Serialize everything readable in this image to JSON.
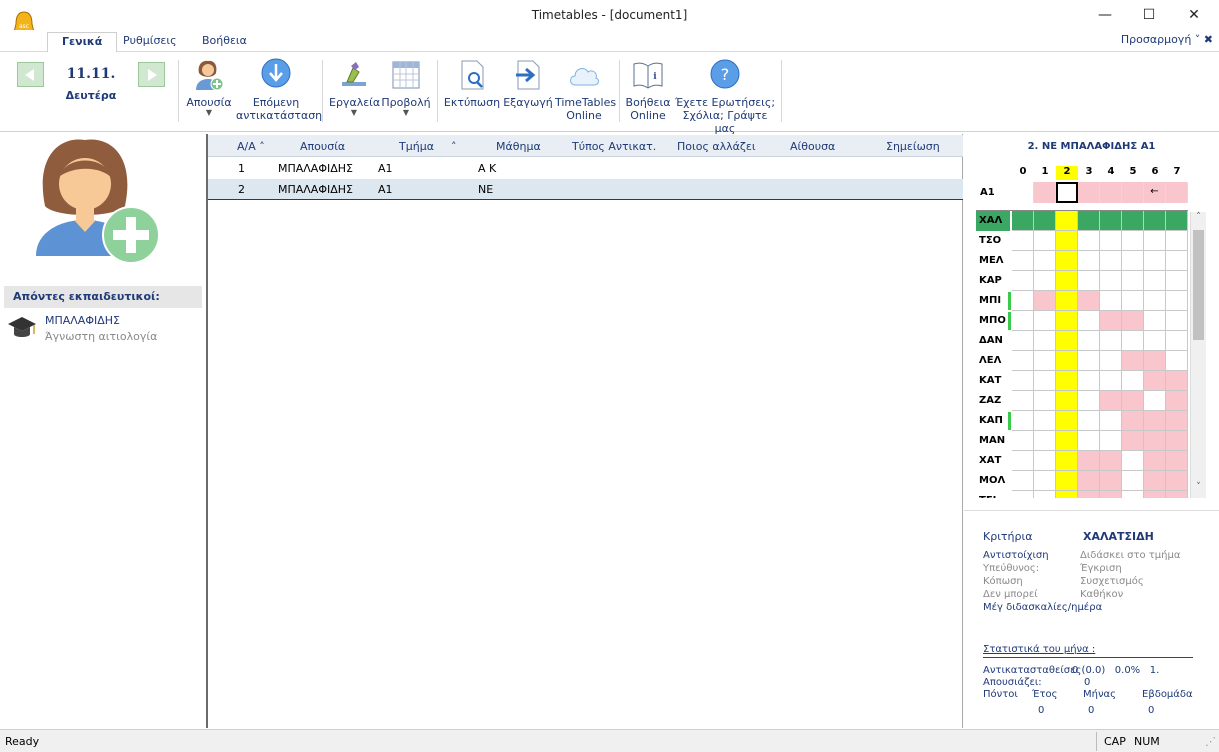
{
  "window": {
    "title": "Timetables - [document1]",
    "minimize": "—",
    "maximize": "☐",
    "close": "✕"
  },
  "tabs": [
    {
      "label": "Γενικά"
    },
    {
      "label": "Ρυθμίσεις"
    },
    {
      "label": "Βοήθεια"
    }
  ],
  "customize": "Προσαρμογή ˅ ✖",
  "date": {
    "main": "11.11.",
    "day": "Δευτέρα"
  },
  "ribbon": {
    "absence": "Απουσία",
    "next_sub_1": "Επόμενη",
    "next_sub_2": "αντικατάσταση",
    "tools": "Εργαλεία",
    "view": "Προβολή",
    "print": "Εκτύπωση",
    "export": "Εξαγωγή",
    "online_1": "TimeTables",
    "online_2": "Online",
    "help_1": "Βοήθεια",
    "help_2": "Online",
    "questions_1": "Έχετε Ερωτήσεις;",
    "questions_2": "Σχόλια; Γράψτε μας"
  },
  "left": {
    "absent_header": "Απόντες εκπαιδευτικοί:",
    "teacher_name": "ΜΠΑΛΑΦΙΔΗΣ",
    "teacher_reason": "Άγνωστη αιτιολογία"
  },
  "table": {
    "columns": [
      "Α/Α ˄",
      "Απουσία",
      "Τμήμα",
      "˄",
      "Μάθημα",
      "Τύπος Αντικατ.",
      "Ποιος αλλάζει",
      "Αίθουσα",
      "Σημείωση"
    ],
    "rows": [
      {
        "num": "1",
        "absence": "ΜΠΑΛΑΦΙΔΗΣ",
        "class": "Α1",
        "subject": "Α Κ"
      },
      {
        "num": "2",
        "absence": "ΜΠΑΛΑΦΙΔΗΣ",
        "class": "Α1",
        "subject": "ΝΕ"
      }
    ]
  },
  "right": {
    "title": "2. ΝΕ ΜΠΑΛΑΦΙΔΗΣ Α1",
    "periods": [
      "0",
      "1",
      "2",
      "3",
      "4",
      "5",
      "6",
      "7"
    ],
    "class_row_label": "Α1",
    "arrow": "←",
    "teachers": [
      "ΧΑΛ",
      "ΤΣΟ",
      "ΜΕΛ",
      "ΚΑΡ",
      "ΜΠΙ",
      "ΜΠΟ",
      "ΔΑΝ",
      "ΛΕΛ",
      "ΚΑΤ",
      "ΖΑΖ",
      "ΚΑΠ",
      "ΜΑΝ",
      "ΧΑΤ",
      "ΜΟΛ",
      "ΤΣΙ"
    ],
    "criteria": "Κριτήρια",
    "criteria_name": "ΧΑΛΑΤΣΙΔΗ",
    "c_left": [
      "Αντιστοίχιση",
      "Υπεύθυνος:",
      "Κόπωση",
      "Δεν μπορεί",
      "Μέγ διδασκαλίες/ημέρα"
    ],
    "c_right": [
      "Διδάσκει στο τμήμα",
      "Έγκριση",
      "Συσχετισμός",
      "Καθήκον"
    ],
    "stats_title": "Στατιστικά του μήνα :",
    "stat_sub_label": "Αντικατασταθείσες",
    "stat_sub_vals": "0 (0.0)   0.0%   1.",
    "stat_abs_label": "Απουσιάζει:",
    "stat_abs_val": "0",
    "points": "Πόντοι",
    "year": "Έτος",
    "month": "Μήνας",
    "week": "Εβδομάδα",
    "year_val": "0",
    "month_val": "0",
    "week_val": "0"
  },
  "status": {
    "ready": "Ready",
    "cap": "CAP",
    "num": "NUM"
  },
  "colors": {
    "accent": "#1f3a77",
    "highlight": "#ffff00",
    "green": "#3aa862",
    "pink": "#f8c6cc"
  }
}
